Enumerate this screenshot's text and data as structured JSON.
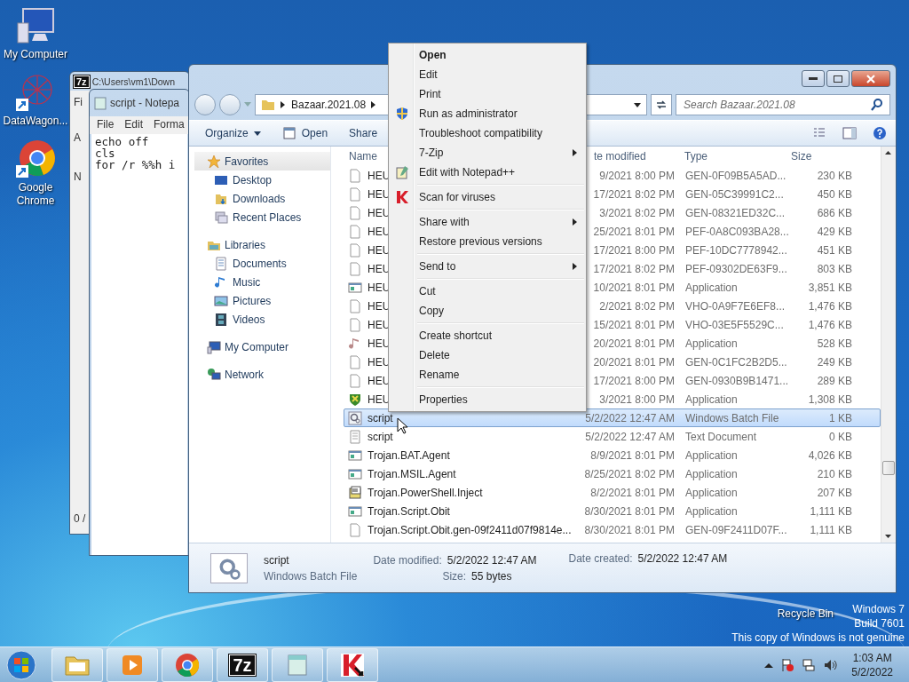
{
  "desktop_icons": [
    {
      "label": "My Computer",
      "kind": "computer"
    },
    {
      "label": "DataWagon...",
      "kind": "network-art"
    },
    {
      "label": "Google Chrome",
      "kind": "chrome"
    }
  ],
  "recycle_bin": {
    "label": "Recycle Bin"
  },
  "windows_notice": [
    "Windows 7",
    "Build 7601",
    "This copy of Windows is not genuine"
  ],
  "archive_window": {
    "logo": "7z",
    "title": "C:\\Users\\vm1\\Down",
    "menu_fragment": "Fi",
    "toolbar_fragment": "A",
    "column_fragment": "N",
    "status_fragment": "0 /"
  },
  "notepad": {
    "title": "script - Notepa",
    "menu": [
      "File",
      "Edit",
      "Forma"
    ],
    "lines": [
      "echo off",
      "cls",
      "for /r %%h i"
    ]
  },
  "explorer": {
    "breadcrumb": [
      "Bazaar.2021.08"
    ],
    "search": {
      "placeholder": "Search Bazaar.2021.08"
    },
    "toolbar": [
      {
        "label": "Organize",
        "kind": "dropdown"
      },
      {
        "label": "Open",
        "kind": "open"
      },
      {
        "label": "Share",
        "kind": "plain"
      }
    ],
    "sidebar": [
      {
        "label": "Favorites",
        "kind": "favorites",
        "children": [
          {
            "label": "Desktop",
            "kind": "desktop"
          },
          {
            "label": "Downloads",
            "kind": "downloads"
          },
          {
            "label": "Recent Places",
            "kind": "recent"
          }
        ]
      },
      {
        "label": "Libraries",
        "kind": "libraries",
        "children": [
          {
            "label": "Documents",
            "kind": "documents"
          },
          {
            "label": "Music",
            "kind": "music"
          },
          {
            "label": "Pictures",
            "kind": "pictures"
          },
          {
            "label": "Videos",
            "kind": "videos"
          }
        ]
      },
      {
        "label": "My Computer",
        "kind": "computer"
      },
      {
        "label": "Network",
        "kind": "network"
      }
    ],
    "columns": [
      "Name",
      "te modified",
      "Type",
      "Size"
    ],
    "rows": [
      {
        "name": "HEU",
        "date": "9/2021 8:00 PM",
        "type": "GEN-0F09B5A5AD...",
        "size": "230 KB",
        "kind": "blank",
        "selected": false
      },
      {
        "name": "HEU",
        "date": "17/2021 8:02 PM",
        "type": "GEN-05C39991C2...",
        "size": "450 KB",
        "kind": "blank",
        "selected": false
      },
      {
        "name": "HEU",
        "date": "3/2021 8:02 PM",
        "type": "GEN-08321ED32C...",
        "size": "686 KB",
        "kind": "blank",
        "selected": false
      },
      {
        "name": "HEU",
        "date": "25/2021 8:01 PM",
        "type": "PEF-0A8C093BA28...",
        "size": "429 KB",
        "kind": "blank",
        "selected": false
      },
      {
        "name": "HEU",
        "date": "17/2021 8:00 PM",
        "type": "PEF-10DC7778942...",
        "size": "451 KB",
        "kind": "blank",
        "selected": false
      },
      {
        "name": "HEU",
        "date": "17/2021 8:02 PM",
        "type": "PEF-09302DE63F9...",
        "size": "803 KB",
        "kind": "blank",
        "selected": false
      },
      {
        "name": "HEU",
        "date": "10/2021 8:01 PM",
        "type": "Application",
        "size": "3,851 KB",
        "kind": "app",
        "selected": false
      },
      {
        "name": "HEU",
        "date": "2/2021 8:02 PM",
        "type": "VHO-0A9F7E6EF8...",
        "size": "1,476 KB",
        "kind": "blank",
        "selected": false
      },
      {
        "name": "HEU",
        "date": "15/2021 8:01 PM",
        "type": "VHO-03E5F5529C...",
        "size": "1,476 KB",
        "kind": "blank",
        "selected": false
      },
      {
        "name": "HEU",
        "date": "20/2021 8:01 PM",
        "type": "Application",
        "size": "528 KB",
        "kind": "music",
        "selected": false
      },
      {
        "name": "HEU",
        "date": "20/2021 8:01 PM",
        "type": "GEN-0C1FC2B2D5...",
        "size": "249 KB",
        "kind": "blank",
        "selected": false
      },
      {
        "name": "HEU",
        "date": "17/2021 8:00 PM",
        "type": "GEN-0930B9B1471...",
        "size": "289 KB",
        "kind": "blank",
        "selected": false
      },
      {
        "name": "HEU",
        "date": "3/2021 8:00 PM",
        "type": "Application",
        "size": "1,308 KB",
        "kind": "shield",
        "selected": false
      },
      {
        "name": "script",
        "date": "5/2/2022 12:47 AM",
        "type": "Windows Batch File",
        "size": "1 KB",
        "kind": "batch",
        "selected": true
      },
      {
        "name": "script",
        "date": "5/2/2022 12:47 AM",
        "type": "Text Document",
        "size": "0 KB",
        "kind": "text",
        "selected": false
      },
      {
        "name": "Trojan.BAT.Agent",
        "date": "8/9/2021 8:01 PM",
        "type": "Application",
        "size": "4,026 KB",
        "kind": "app",
        "selected": false
      },
      {
        "name": "Trojan.MSIL.Agent",
        "date": "8/25/2021 8:02 PM",
        "type": "Application",
        "size": "210 KB",
        "kind": "app",
        "selected": false
      },
      {
        "name": "Trojan.PowerShell.Inject",
        "date": "8/2/2021 8:01 PM",
        "type": "Application",
        "size": "207 KB",
        "kind": "script",
        "selected": false
      },
      {
        "name": "Trojan.Script.Obit",
        "date": "8/30/2021 8:01 PM",
        "type": "Application",
        "size": "1,111 KB",
        "kind": "app",
        "selected": false
      },
      {
        "name": "Trojan.Script.Obit.gen-09f2411d07f9814e...",
        "date": "8/30/2021 8:01 PM",
        "type": "GEN-09F2411D07F...",
        "size": "1,111 KB",
        "kind": "blank",
        "selected": false
      }
    ],
    "details": {
      "name": "script",
      "type": "Windows Batch File",
      "modified_label": "Date modified:",
      "modified": "5/2/2022 12:47 AM",
      "size_label": "Size:",
      "size": "55 bytes",
      "created_label": "Date created:",
      "created": "5/2/2022 12:47 AM"
    }
  },
  "context_menu": [
    {
      "kind": "command",
      "label": "Open",
      "is_default": true,
      "submenu": false
    },
    {
      "kind": "command",
      "label": "Edit",
      "is_default": false,
      "submenu": false
    },
    {
      "kind": "command",
      "label": "Print",
      "is_default": false,
      "submenu": false
    },
    {
      "kind": "admin",
      "label": "Run as administrator",
      "is_default": false,
      "submenu": false
    },
    {
      "kind": "command",
      "label": "Troubleshoot compatibility",
      "is_default": false,
      "submenu": false
    },
    {
      "kind": "command",
      "label": "7-Zip",
      "is_default": false,
      "submenu": true
    },
    {
      "kind": "editor",
      "label": "Edit with Notepad++",
      "is_default": false,
      "submenu": false
    },
    {
      "kind": "separator"
    },
    {
      "kind": "scan",
      "label": "Scan for viruses",
      "is_default": false,
      "submenu": false
    },
    {
      "kind": "separator"
    },
    {
      "kind": "command",
      "label": "Share with",
      "is_default": false,
      "submenu": true
    },
    {
      "kind": "command",
      "label": "Restore previous versions",
      "is_default": false,
      "submenu": false
    },
    {
      "kind": "separator"
    },
    {
      "kind": "command",
      "label": "Send to",
      "is_default": false,
      "submenu": true
    },
    {
      "kind": "separator"
    },
    {
      "kind": "command",
      "label": "Cut",
      "is_default": false,
      "submenu": false
    },
    {
      "kind": "command",
      "label": "Copy",
      "is_default": false,
      "submenu": false
    },
    {
      "kind": "separator"
    },
    {
      "kind": "command",
      "label": "Create shortcut",
      "is_default": false,
      "submenu": false
    },
    {
      "kind": "command",
      "label": "Delete",
      "is_default": false,
      "submenu": false
    },
    {
      "kind": "command",
      "label": "Rename",
      "is_default": false,
      "submenu": false
    },
    {
      "kind": "separator"
    },
    {
      "kind": "command",
      "label": "Properties",
      "is_default": false,
      "submenu": false
    }
  ],
  "taskbar": {
    "items": [
      {
        "kind": "explorer"
      },
      {
        "kind": "media"
      },
      {
        "kind": "chrome"
      },
      {
        "kind": "archiver",
        "label": "7z"
      },
      {
        "kind": "notepad"
      },
      {
        "kind": "antivirus"
      }
    ],
    "time": "1:03 AM",
    "date": "5/2/2022"
  }
}
